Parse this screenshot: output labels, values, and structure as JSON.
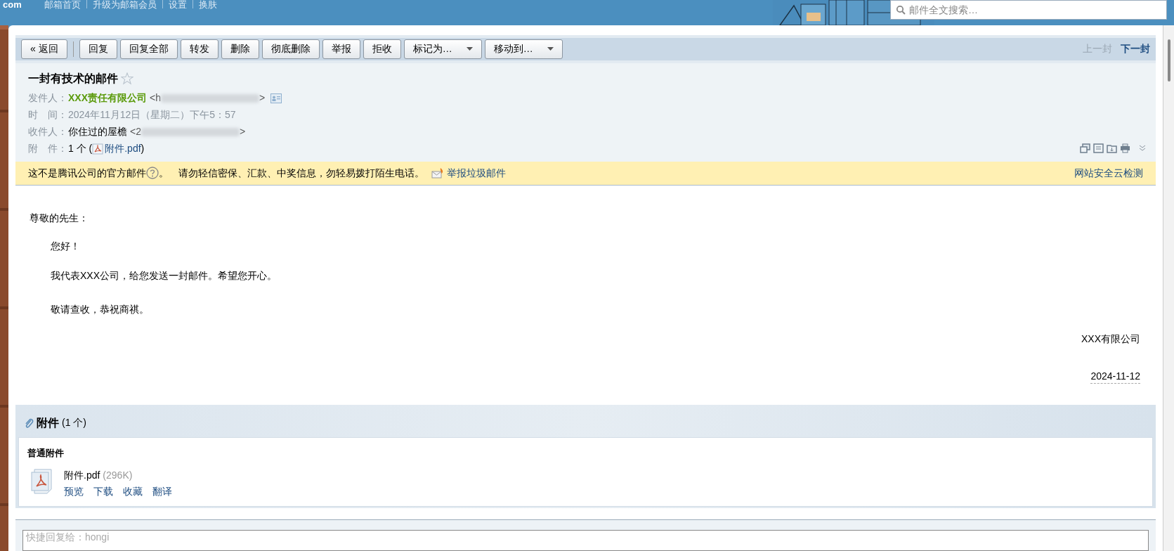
{
  "top_nav": {
    "logo_fragment": "com",
    "links": [
      "邮箱首页",
      "升级为邮箱会员",
      "设置",
      "换肤"
    ],
    "search": {
      "placeholder": "邮件全文搜索…"
    }
  },
  "toolbar": {
    "buttons": [
      {
        "label": "« 返回",
        "kind": "plain"
      },
      {
        "label": "回复",
        "kind": "plain"
      },
      {
        "label": "回复全部",
        "kind": "plain"
      },
      {
        "label": "转发",
        "kind": "plain"
      },
      {
        "label": "删除",
        "kind": "plain"
      },
      {
        "label": "彻底删除",
        "kind": "plain"
      },
      {
        "label": "举报",
        "kind": "plain"
      },
      {
        "label": "拒收",
        "kind": "plain"
      },
      {
        "label": "标记为…",
        "kind": "dropdown"
      },
      {
        "label": "移动到…",
        "kind": "dropdown"
      }
    ],
    "nav": [
      {
        "label": "上一封",
        "disabled": true
      },
      {
        "label": "下一封",
        "disabled": false
      }
    ]
  },
  "header": {
    "subject": "一封有技术的邮件",
    "starred": false,
    "rows": [
      {
        "label": "发件人：",
        "kind": "sender",
        "name": "XXX责任有限公司",
        "address_start": "<h",
        "address_end": ">"
      },
      {
        "label": "时　间：",
        "kind": "text",
        "value": "2024年11月12日（星期二）下午5：57"
      },
      {
        "label": "收件人：",
        "kind": "recipient",
        "name": "你住过的屋檐",
        "address_start": "<2",
        "address_end": ">"
      },
      {
        "label": "附　件：",
        "kind": "attachment",
        "count": "1 个 (",
        "file": "附件.pdf",
        "close": ")"
      }
    ]
  },
  "warning": {
    "text": "这不是腾讯公司的官方邮件",
    "notice": "。　请勿轻信密保、汇款、中奖信息，勿轻易拨打陌生电话。",
    "report_link": "举报垃圾邮件",
    "right_link": "网站安全云检测"
  },
  "body": {
    "greeting": "尊敬的先生：",
    "paragraphs": [
      "您好！",
      "我代表XXX公司，给您发送一封邮件。希望您开心。",
      "敬请查收，恭祝商祺。"
    ],
    "signature": "XXX有限公司",
    "date": "2024-11-12"
  },
  "attachments": {
    "title": "附件",
    "count": "(1 个)",
    "group": "普通附件",
    "files": [
      {
        "name": "附件.pdf",
        "size": "(296K)",
        "actions": [
          "预览",
          "下载",
          "收藏",
          "翻译"
        ]
      }
    ]
  },
  "quick_reply": {
    "placeholder": "快捷回复给：hongi"
  }
}
